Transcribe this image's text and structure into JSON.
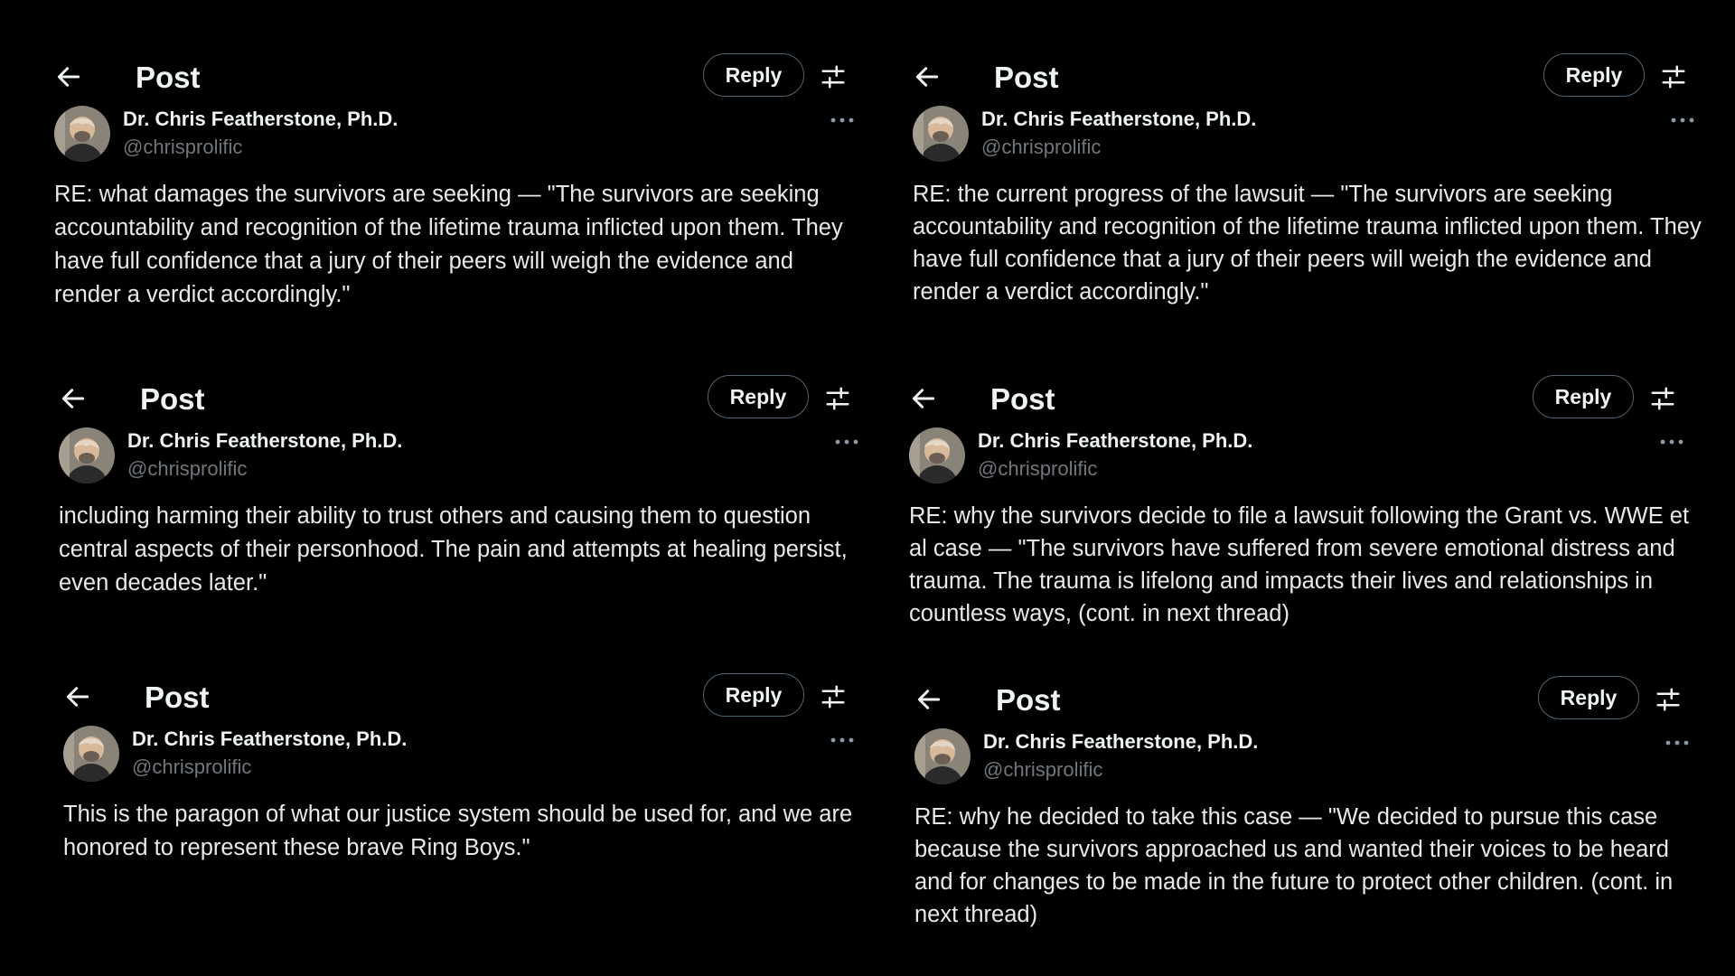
{
  "posts": [
    {
      "header_title": "Post",
      "reply_label": "Reply",
      "author_name": "Dr. Chris Featherstone, Ph.D.",
      "author_handle": "@chrisprolific",
      "text": "RE: what damages the survivors are seeking — \"The survivors are seeking accountability and recognition of the lifetime trauma inflicted upon them. They have full confidence that a jury of their peers will weigh the evidence and render a verdict accordingly.\""
    },
    {
      "header_title": "Post",
      "reply_label": "Reply",
      "author_name": "Dr. Chris Featherstone, Ph.D.",
      "author_handle": "@chrisprolific",
      "text": "RE: the current progress of the lawsuit — \"The survivors are seeking accountability and recognition of the lifetime trauma inflicted upon them. They have full confidence that a jury of their peers will weigh the evidence and render a verdict accordingly.\""
    },
    {
      "header_title": "Post",
      "reply_label": "Reply",
      "author_name": "Dr. Chris Featherstone, Ph.D.",
      "author_handle": "@chrisprolific",
      "text": "including harming their ability to trust others and causing them to question central aspects of their personhood. The pain and attempts at healing persist, even decades later.\""
    },
    {
      "header_title": "Post",
      "reply_label": "Reply",
      "author_name": "Dr. Chris Featherstone, Ph.D.",
      "author_handle": "@chrisprolific",
      "text": "RE: why the survivors decide to file a lawsuit following the Grant vs. WWE et al case — \"The survivors have suffered from severe emotional distress and trauma. The trauma is lifelong and impacts their lives and relationships in countless ways, (cont. in next thread)"
    },
    {
      "header_title": "Post",
      "reply_label": "Reply",
      "author_name": "Dr. Chris Featherstone, Ph.D.",
      "author_handle": "@chrisprolific",
      "text": "This is the paragon of what our justice system should be used for, and we are honored to represent these brave Ring Boys.\""
    },
    {
      "header_title": "Post",
      "reply_label": "Reply",
      "author_name": "Dr. Chris Featherstone, Ph.D.",
      "author_handle": "@chrisprolific",
      "text": "RE: why he decided to take this case — \"We decided to pursue this case because the survivors approached us and wanted their voices to be heard and for changes to be made in the future to protect other children. (cont. in next thread)"
    }
  ],
  "icons": {
    "back": "arrow-left-icon",
    "tune": "sliders-icon",
    "more": "more-dots-icon"
  },
  "colors": {
    "background": "#000000",
    "text": "#e7e9ea",
    "handle": "#71767b",
    "border": "#536471"
  }
}
